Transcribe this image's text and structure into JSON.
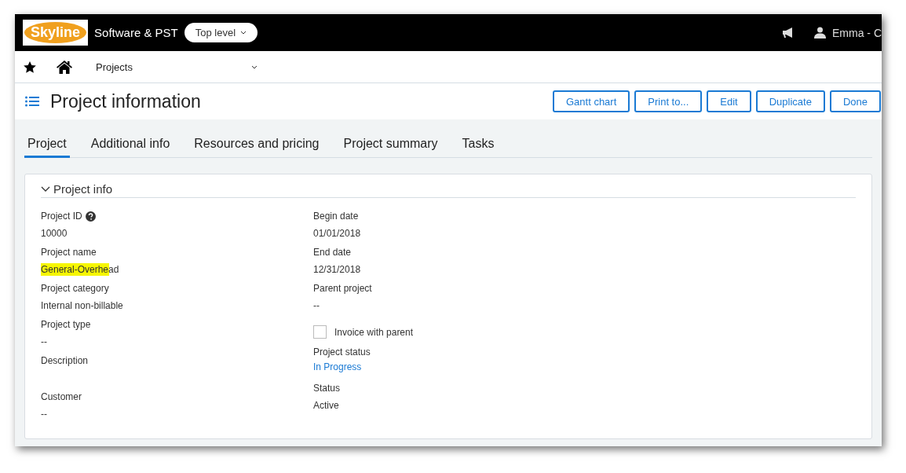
{
  "header": {
    "logo": "Skyline",
    "company": "Software & PST",
    "level_selector": "Top level",
    "user": "Emma - C"
  },
  "nav": {
    "breadcrumb": "Projects"
  },
  "page": {
    "title": "Project information",
    "buttons": [
      "Gantt chart",
      "Print to...",
      "Edit",
      "Duplicate",
      "Done"
    ]
  },
  "tabs": [
    {
      "label": "Project",
      "selected": true
    },
    {
      "label": "Additional info",
      "selected": false
    },
    {
      "label": "Resources and pricing",
      "selected": false
    },
    {
      "label": "Project summary",
      "selected": false
    },
    {
      "label": "Tasks",
      "selected": false
    }
  ],
  "section": {
    "title": "Project info",
    "expanded": true,
    "left_fields": [
      {
        "kind": "field",
        "label": "Project ID",
        "help": true,
        "value": "10000"
      },
      {
        "kind": "field",
        "label": "Project name",
        "value": "General-Overhead",
        "highlighted": true
      },
      {
        "kind": "field",
        "label": "Project category",
        "value": "Internal non-billable"
      },
      {
        "kind": "field",
        "label": "Project type",
        "value": "--"
      },
      {
        "kind": "field",
        "label": "Description"
      },
      {
        "kind": "field",
        "label": "Customer",
        "value": "--"
      }
    ],
    "right_fields": [
      {
        "kind": "field",
        "label": "Begin date",
        "value": "01/01/2018"
      },
      {
        "kind": "field",
        "label": "End date",
        "value": "12/31/2018"
      },
      {
        "kind": "field",
        "label": "Parent project",
        "value": "--"
      },
      {
        "kind": "checkbox",
        "label": "Invoice with parent",
        "checked": false
      },
      {
        "kind": "link",
        "label": "Project status",
        "value": "In Progress"
      },
      {
        "kind": "field",
        "label": "Status",
        "value": "Active"
      }
    ]
  }
}
